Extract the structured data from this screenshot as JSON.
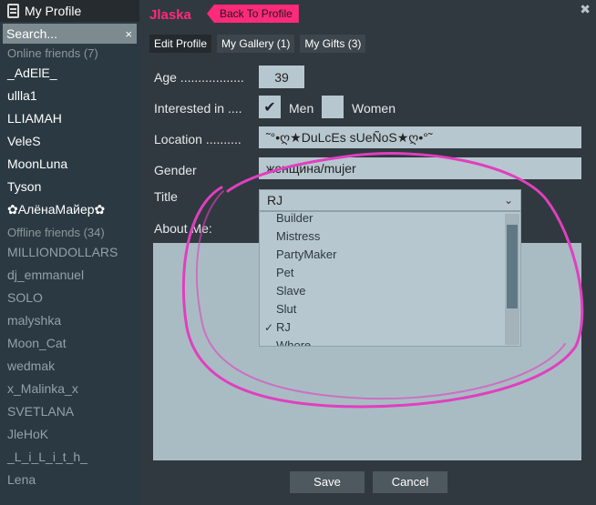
{
  "sidebar": {
    "title": "My Profile",
    "search_placeholder": "Search...",
    "clear_glyph": "×",
    "online_header": "Online friends (7)",
    "online": [
      "_AdElE_",
      "ullla1",
      "LLIAMAH",
      "VeleS",
      "MoonLuna",
      "Tyson",
      "✿АлёнаМайер✿"
    ],
    "offline_header": "Offline friends (34)",
    "offline": [
      "MILLIONDOLLARS",
      "dj_emmanuel",
      "SOLO",
      "malyshka",
      "Moon_Cat",
      "wedmak",
      "x_Malinka_x",
      "SVETLANA",
      "JleHoK",
      "_L_i_L_i_t_h_",
      "Lena"
    ]
  },
  "header": {
    "username": "Jlaska",
    "back_label": "Back To Profile",
    "close_glyph": "✖"
  },
  "tabs": [
    {
      "label": "Edit Profile",
      "active": true
    },
    {
      "label": "My Gallery (1)",
      "active": false
    },
    {
      "label": "My Gifts (3)",
      "active": false
    }
  ],
  "form": {
    "age_label": "Age ..................",
    "age_value": "39",
    "interested_label": "Interested in ....",
    "men_label": "Men",
    "men_checked": true,
    "women_label": "Women",
    "women_checked": false,
    "check_glyph": "✔",
    "location_label": "Location ..........",
    "location_value": "˜°•ღ★DuLcEs sUeÑoS★ღ•°˜",
    "gender_label": "Gender",
    "gender_value": "женщина/mujer",
    "title_label": "Title",
    "title_value": "RJ",
    "title_chevron": "⌄",
    "title_options": [
      "Builder",
      "Mistress",
      "PartyMaker",
      "Pet",
      "Slave",
      "Slut",
      "RJ",
      "Whore"
    ],
    "title_selected_index": 6,
    "option_check_glyph": "✓",
    "about_label": "About Me:",
    "about_value": ""
  },
  "actions": {
    "save_label": "Save",
    "cancel_label": "Cancel"
  },
  "colors": {
    "accent": "#ff2a7a",
    "annotation": "#e13fbf"
  }
}
